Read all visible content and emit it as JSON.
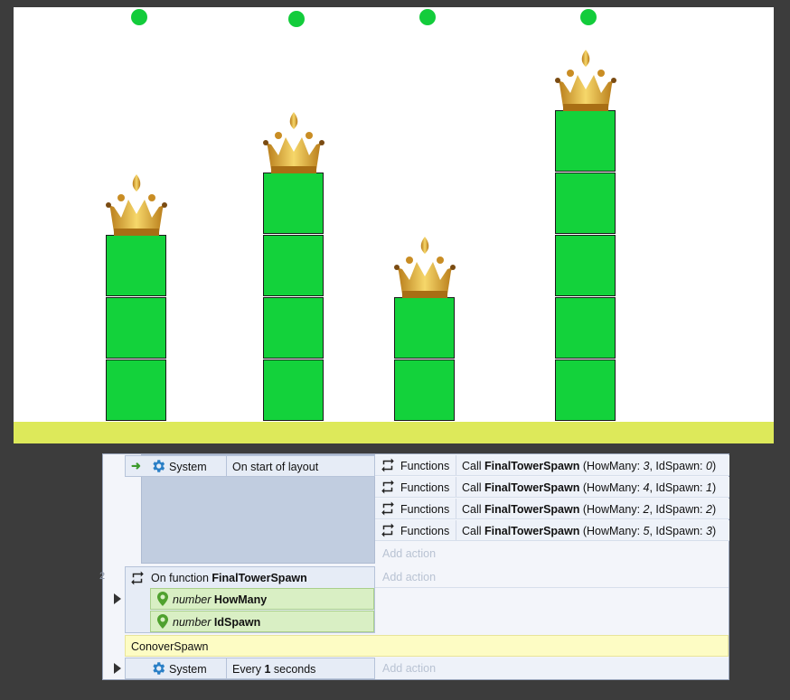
{
  "game": {
    "background": "#ffffff",
    "ground_color": "#dde95a",
    "block_color": "#13d23b",
    "spawn_marker_color": "#13cc3b",
    "spawn_points": [
      "spawn-0",
      "spawn-1",
      "spawn-2",
      "spawn-3"
    ],
    "towers": [
      {
        "id_spawn": 0,
        "how_many": 3
      },
      {
        "id_spawn": 1,
        "how_many": 4
      },
      {
        "id_spawn": 2,
        "how_many": 2
      },
      {
        "id_spawn": 3,
        "how_many": 5
      }
    ],
    "tower_top_icon": "crown-icon"
  },
  "events": {
    "event1": {
      "arrow_icon": "start-arrow-icon",
      "object_icon": "gear-icon",
      "object": "System",
      "condition": "On start of layout",
      "actions": [
        {
          "object": "Functions",
          "call": "Call",
          "function": "FinalTowerSpawn",
          "param1_name": "HowMany",
          "param1_value": "3",
          "param2_name": "IdSpawn",
          "param2_value": "0"
        },
        {
          "object": "Functions",
          "call": "Call",
          "function": "FinalTowerSpawn",
          "param1_name": "HowMany",
          "param1_value": "4",
          "param2_name": "IdSpawn",
          "param2_value": "1"
        },
        {
          "object": "Functions",
          "call": "Call",
          "function": "FinalTowerSpawn",
          "param1_name": "HowMany",
          "param1_value": "2",
          "param2_name": "IdSpawn",
          "param2_value": "2"
        },
        {
          "object": "Functions",
          "call": "Call",
          "function": "FinalTowerSpawn",
          "param1_name": "HowMany",
          "param1_value": "5",
          "param2_name": "IdSpawn",
          "param2_value": "3"
        }
      ],
      "add_action": "Add action"
    },
    "event2": {
      "line_number": "2",
      "prefix": "On function",
      "function_name": "FinalTowerSpawn",
      "params": [
        {
          "type": "number",
          "name": "HowMany"
        },
        {
          "type": "number",
          "name": "IdSpawn"
        }
      ],
      "add_action": "Add action"
    },
    "comment": "ConoverSpawn",
    "event3": {
      "object": "System",
      "prefix": "Every",
      "value": "1",
      "suffix": "seconds",
      "add_action": "Add action"
    }
  }
}
